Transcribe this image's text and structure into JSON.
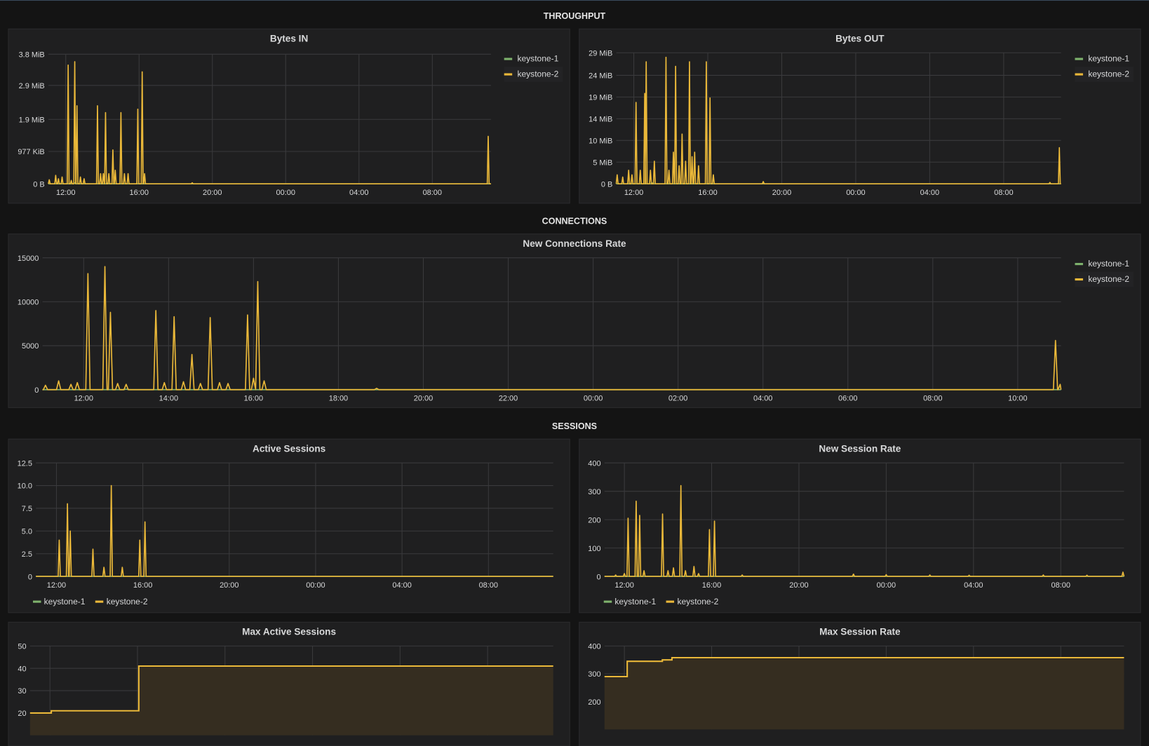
{
  "rows": {
    "throughput": "THROUGHPUT",
    "connections": "CONNECTIONS",
    "sessions": "SESSIONS"
  },
  "colors": {
    "keystone-1": "#7eb26d",
    "keystone-2": "#eab839",
    "grid": "#3a3a3c",
    "fill": "#352d20"
  },
  "legend": [
    "keystone-1",
    "keystone-2"
  ],
  "chart_data": [
    {
      "id": "bytes_in",
      "type": "line",
      "title": "Bytes IN",
      "xdomain": [
        11.05,
        35.2
      ],
      "xticks": [
        [
          12,
          "12:00"
        ],
        [
          16,
          "16:00"
        ],
        [
          20,
          "20:00"
        ],
        [
          24,
          "00:00"
        ],
        [
          28,
          "04:00"
        ],
        [
          32,
          "08:00"
        ]
      ],
      "ylim": [
        0,
        3.82
      ],
      "yticks": [
        [
          0,
          "0 B"
        ],
        [
          0.954,
          "977 KiB"
        ],
        [
          1.9,
          "1.9 MiB"
        ],
        [
          2.9,
          "2.9 MiB"
        ],
        [
          3.82,
          "3.8 MiB"
        ]
      ],
      "legend_position": "right",
      "unit": "MiB",
      "series": [
        {
          "name": "keystone-1",
          "spikes": [
            [
              12.5,
              0.03
            ],
            [
              14.3,
              0.03
            ]
          ]
        },
        {
          "name": "keystone-2",
          "spikes": [
            [
              11.1,
              0.12
            ],
            [
              11.45,
              0.25
            ],
            [
              11.6,
              0.15
            ],
            [
              11.8,
              0.2
            ],
            [
              12.13,
              3.5
            ],
            [
              12.3,
              0.1
            ],
            [
              12.49,
              3.6
            ],
            [
              12.61,
              2.3
            ],
            [
              12.8,
              0.2
            ],
            [
              13.0,
              0.15
            ],
            [
              13.73,
              2.3
            ],
            [
              13.9,
              0.3
            ],
            [
              14.05,
              0.3
            ],
            [
              14.17,
              2.1
            ],
            [
              14.35,
              0.3
            ],
            [
              14.57,
              1.0
            ],
            [
              14.7,
              0.4
            ],
            [
              15.01,
              2.1
            ],
            [
              15.2,
              0.3
            ],
            [
              15.4,
              0.3
            ],
            [
              15.93,
              2.2
            ],
            [
              16.17,
              3.3
            ],
            [
              16.3,
              0.3
            ],
            [
              18.9,
              0.03
            ],
            [
              35.05,
              1.4
            ]
          ]
        }
      ]
    },
    {
      "id": "bytes_out",
      "type": "line",
      "title": "Bytes OUT",
      "xdomain": [
        11.05,
        35.1
      ],
      "xticks": [
        [
          12,
          "12:00"
        ],
        [
          16,
          "16:00"
        ],
        [
          20,
          "20:00"
        ],
        [
          24,
          "00:00"
        ],
        [
          28,
          "04:00"
        ],
        [
          32,
          "08:00"
        ]
      ],
      "ylim": [
        0,
        29
      ],
      "yticks": [
        [
          0,
          "0 B"
        ],
        [
          4.8,
          "5 MiB"
        ],
        [
          9.6,
          "10 MiB"
        ],
        [
          14.4,
          "14 MiB"
        ],
        [
          19.2,
          "19 MiB"
        ],
        [
          24,
          "24 MiB"
        ],
        [
          29,
          "29 MiB"
        ]
      ],
      "legend_position": "right",
      "unit": "MiB",
      "series": [
        {
          "name": "keystone-1",
          "spikes": [
            [
              13.0,
              0.2
            ]
          ]
        },
        {
          "name": "keystone-2",
          "spikes": [
            [
              11.1,
              2
            ],
            [
              11.4,
              1.5
            ],
            [
              11.72,
              3
            ],
            [
              11.9,
              2
            ],
            [
              12.12,
              18
            ],
            [
              12.35,
              3
            ],
            [
              12.59,
              20
            ],
            [
              12.67,
              27
            ],
            [
              12.9,
              3
            ],
            [
              13.11,
              5
            ],
            [
              13.74,
              28
            ],
            [
              13.9,
              3
            ],
            [
              14.14,
              7
            ],
            [
              14.26,
              26
            ],
            [
              14.45,
              4
            ],
            [
              14.61,
              11
            ],
            [
              14.8,
              5
            ],
            [
              15.01,
              27
            ],
            [
              15.15,
              6
            ],
            [
              15.29,
              7
            ],
            [
              15.5,
              4
            ],
            [
              15.92,
              27
            ],
            [
              16.12,
              19
            ],
            [
              16.3,
              2
            ],
            [
              19.0,
              0.5
            ],
            [
              34.5,
              0.3
            ],
            [
              35.01,
              8
            ]
          ]
        }
      ]
    },
    {
      "id": "new_conn",
      "type": "line",
      "title": "New Connections Rate",
      "xdomain": [
        11.03,
        35.02
      ],
      "xticks": [
        [
          12,
          "12:00"
        ],
        [
          14,
          "14:00"
        ],
        [
          16,
          "16:00"
        ],
        [
          18,
          "18:00"
        ],
        [
          20,
          "20:00"
        ],
        [
          22,
          "22:00"
        ],
        [
          24,
          "00:00"
        ],
        [
          26,
          "02:00"
        ],
        [
          28,
          "04:00"
        ],
        [
          30,
          "06:00"
        ],
        [
          32,
          "08:00"
        ],
        [
          34,
          "10:00"
        ]
      ],
      "ylim": [
        0,
        15000
      ],
      "yticks": [
        [
          0,
          "0"
        ],
        [
          5000,
          "5000"
        ],
        [
          10000,
          "10000"
        ],
        [
          15000,
          "15000"
        ]
      ],
      "legend_position": "right",
      "series": [
        {
          "name": "keystone-1",
          "spikes": [
            [
              13.0,
              50
            ]
          ]
        },
        {
          "name": "keystone-2",
          "spikes": [
            [
              11.1,
              500
            ],
            [
              11.41,
              1000
            ],
            [
              11.7,
              600
            ],
            [
              11.85,
              800
            ],
            [
              12.1,
              13200
            ],
            [
              12.5,
              14000
            ],
            [
              12.63,
              8800
            ],
            [
              12.8,
              700
            ],
            [
              13.0,
              600
            ],
            [
              13.7,
              9000
            ],
            [
              13.9,
              800
            ],
            [
              14.13,
              8300
            ],
            [
              14.35,
              900
            ],
            [
              14.55,
              4000
            ],
            [
              14.75,
              700
            ],
            [
              14.98,
              8200
            ],
            [
              15.2,
              800
            ],
            [
              15.4,
              700
            ],
            [
              15.86,
              8500
            ],
            [
              16.0,
              1300
            ],
            [
              16.1,
              12300
            ],
            [
              16.25,
              1000
            ],
            [
              18.9,
              150
            ],
            [
              34.89,
              5600
            ],
            [
              35.0,
              600
            ]
          ]
        }
      ]
    },
    {
      "id": "active_sessions",
      "type": "line",
      "title": "Active Sessions",
      "xdomain": [
        11.05,
        35.0
      ],
      "xticks": [
        [
          12,
          "12:00"
        ],
        [
          16,
          "16:00"
        ],
        [
          20,
          "20:00"
        ],
        [
          24,
          "00:00"
        ],
        [
          28,
          "04:00"
        ],
        [
          32,
          "08:00"
        ]
      ],
      "ylim": [
        0,
        12.5
      ],
      "yticks": [
        [
          0,
          "0"
        ],
        [
          2.5,
          "2.5"
        ],
        [
          5,
          "5.0"
        ],
        [
          7.5,
          "7.5"
        ],
        [
          10,
          "10.0"
        ],
        [
          12.5,
          "12.5"
        ]
      ],
      "legend_position": "bottom",
      "series": [
        {
          "name": "keystone-1",
          "spikes": []
        },
        {
          "name": "keystone-2",
          "spikes": [
            [
              12.13,
              4
            ],
            [
              12.51,
              8
            ],
            [
              12.64,
              5
            ],
            [
              13.69,
              3
            ],
            [
              14.2,
              1
            ],
            [
              14.54,
              10
            ],
            [
              15.05,
              1
            ],
            [
              15.86,
              4
            ],
            [
              16.1,
              6
            ]
          ]
        }
      ]
    },
    {
      "id": "new_session_rate",
      "type": "line",
      "title": "New Session Rate",
      "xdomain": [
        11.09,
        34.9
      ],
      "xticks": [
        [
          12,
          "12:00"
        ],
        [
          16,
          "16:00"
        ],
        [
          20,
          "20:00"
        ],
        [
          24,
          "00:00"
        ],
        [
          28,
          "04:00"
        ],
        [
          32,
          "08:00"
        ]
      ],
      "ylim": [
        0,
        400
      ],
      "yticks": [
        [
          0,
          "0"
        ],
        [
          100,
          "100"
        ],
        [
          200,
          "200"
        ],
        [
          300,
          "300"
        ],
        [
          400,
          "400"
        ]
      ],
      "legend_position": "bottom",
      "series": [
        {
          "name": "keystone-1",
          "spikes": []
        },
        {
          "name": "keystone-2",
          "spikes": [
            [
              11.6,
              5
            ],
            [
              12.0,
              10
            ],
            [
              12.17,
              205
            ],
            [
              12.54,
              265
            ],
            [
              12.7,
              215
            ],
            [
              12.9,
              20
            ],
            [
              13.75,
              220
            ],
            [
              14.0,
              20
            ],
            [
              14.25,
              30
            ],
            [
              14.59,
              320
            ],
            [
              14.8,
              20
            ],
            [
              15.19,
              35
            ],
            [
              15.4,
              10
            ],
            [
              15.9,
              165
            ],
            [
              16.13,
              195
            ],
            [
              17.4,
              5
            ],
            [
              22.5,
              8
            ],
            [
              24.0,
              6
            ],
            [
              26.0,
              5
            ],
            [
              27.8,
              4
            ],
            [
              31.2,
              5
            ],
            [
              33.2,
              4
            ],
            [
              34.85,
              15
            ]
          ]
        }
      ]
    },
    {
      "id": "max_active_sessions",
      "type": "area",
      "title": "Max Active Sessions",
      "xdomain": [
        11.09,
        35.0
      ],
      "xticks": [
        [
          12,
          ""
        ],
        [
          16,
          ""
        ],
        [
          20,
          ""
        ],
        [
          24,
          ""
        ],
        [
          28,
          ""
        ],
        [
          32,
          ""
        ]
      ],
      "ylim": [
        10,
        50
      ],
      "yticks": [
        [
          20,
          "20"
        ],
        [
          30,
          "30"
        ],
        [
          40,
          "40"
        ],
        [
          50,
          "50"
        ]
      ],
      "series": [
        {
          "name": "keystone-2",
          "steps": [
            [
              11.09,
              20
            ],
            [
              12.06,
              21
            ],
            [
              16.06,
              41
            ],
            [
              35.0,
              41
            ]
          ]
        }
      ]
    },
    {
      "id": "max_session_rate",
      "type": "area",
      "title": "Max Session Rate",
      "xdomain": [
        11.09,
        34.9
      ],
      "xticks": [
        [
          12,
          ""
        ],
        [
          16,
          ""
        ],
        [
          20,
          ""
        ],
        [
          24,
          ""
        ],
        [
          28,
          ""
        ],
        [
          32,
          ""
        ]
      ],
      "ylim": [
        100,
        400
      ],
      "yticks": [
        [
          200,
          "200"
        ],
        [
          300,
          "300"
        ],
        [
          400,
          "400"
        ]
      ],
      "series": [
        {
          "name": "keystone-2",
          "steps": [
            [
              11.09,
              290
            ],
            [
              12.13,
              345
            ],
            [
              13.74,
              350
            ],
            [
              14.18,
              358
            ],
            [
              34.9,
              358
            ]
          ]
        }
      ]
    }
  ]
}
